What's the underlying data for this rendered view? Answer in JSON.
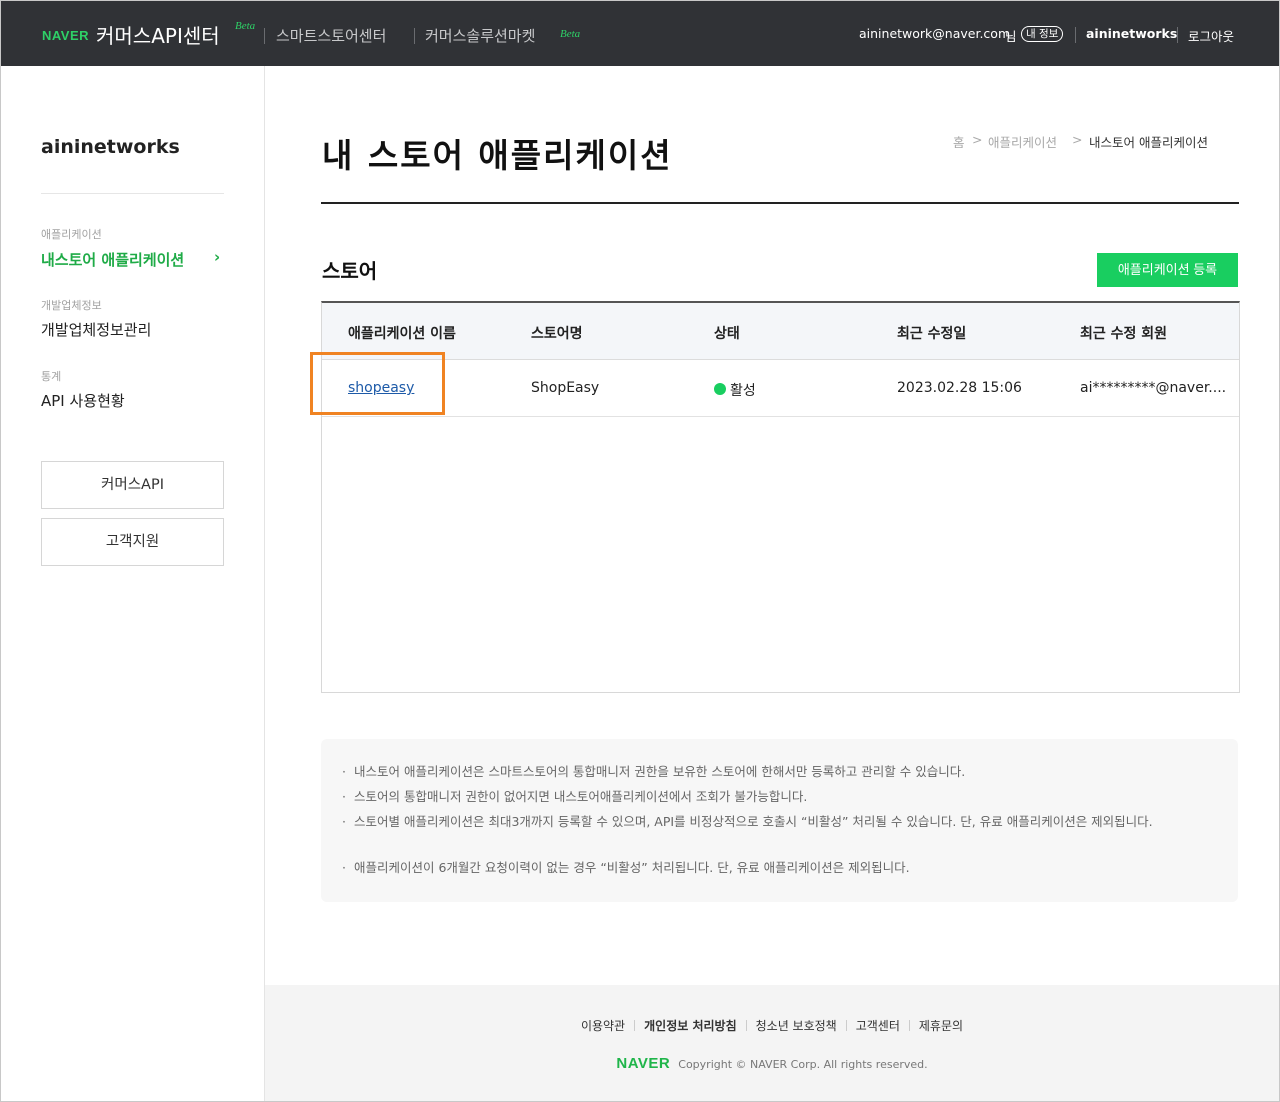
{
  "topbar": {
    "naver": "NAVER",
    "title": "커머스API센터",
    "beta": "Beta",
    "link1": "스마트스토어센터",
    "link2": "커머스솔루션마켓",
    "link2_beta": "Beta",
    "email": "aininetwork@naver.com",
    "suffix": "님",
    "my_info": "내 정보",
    "account": "aininetworks",
    "logout": "로그아웃"
  },
  "sidebar": {
    "store_name": "aininetworks",
    "groups": [
      {
        "category": "애플리케이션",
        "item": "내스토어 애플리케이션"
      },
      {
        "category": "개발업체정보",
        "item": "개발업체정보관리"
      },
      {
        "category": "통계",
        "item": "API 사용현황"
      }
    ],
    "buttons": [
      "커머스API",
      "고객지원"
    ]
  },
  "main": {
    "title": "내 스토어 애플리케이션",
    "breadcrumb": [
      "홈",
      "애플리케이션",
      "내스토어 애플리케이션"
    ],
    "section_title": "스토어",
    "register_button": "애플리케이션 등록",
    "table": {
      "headers": [
        "애플리케이션 이름",
        "스토어명",
        "상태",
        "최근 수정일",
        "최근 수정 회원"
      ],
      "rows": [
        {
          "app_name": "shopeasy",
          "store": "ShopEasy",
          "status": "활성",
          "modified": "2023.02.28 15:06",
          "member": "ai*********@naver...."
        }
      ]
    },
    "notices": [
      "내스토어 애플리케이션은 스마트스토어의 통합매니저 권한을 보유한 스토어에 한해서만 등록하고 관리할 수 있습니다.",
      "스토어의 통합매니저 권한이 없어지면 내스토어애플리케이션에서 조회가 불가능합니다.",
      "스토어별 애플리케이션은 최대3개까지 등록할 수 있으며, API를 비정상적으로 호출시 “비활성” 처리될 수 있습니다. 단, 유료 애플리케이션은 제외됩니다.",
      "애플리케이션이 6개월간 요청이력이 없는 경우 “비활성” 처리됩니다. 단, 유료 애플리케이션은 제외됩니다."
    ]
  },
  "footer": {
    "links": [
      "이용약관",
      "개인정보 처리방침",
      "청소년 보호정책",
      "고객센터",
      "제휴문의"
    ],
    "naver": "NAVER",
    "copyright": "Copyright © NAVER Corp. All rights reserved."
  },
  "colors": {
    "accent": "#19ce60",
    "topbar": "#303236",
    "highlight": "#f08322",
    "link": "#1d5aa8"
  }
}
